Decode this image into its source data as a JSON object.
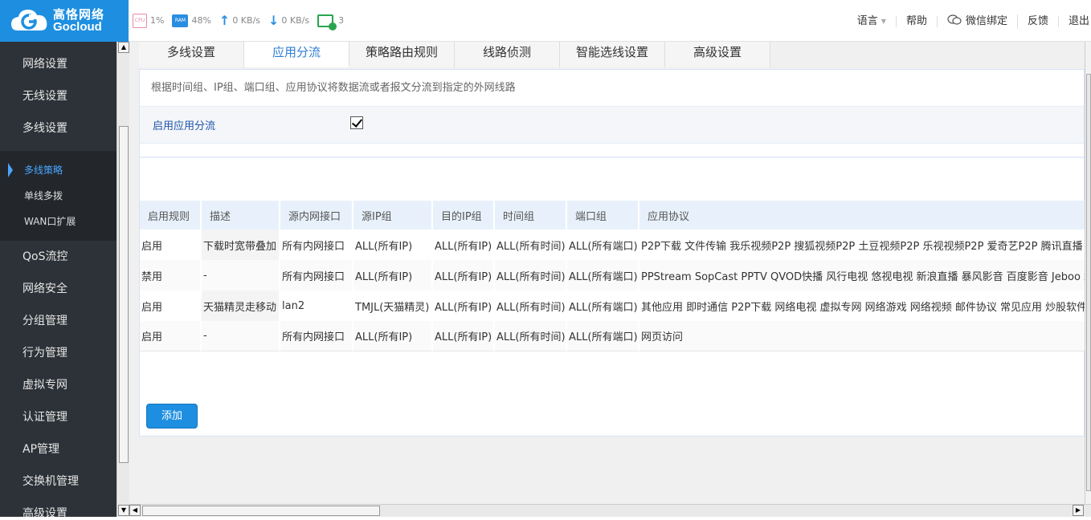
{
  "brand": {
    "name_cn": "高恪网络",
    "name_en": "Gocloud",
    "accent": "#1e8fe0"
  },
  "stats": {
    "cpu_label": "CPU",
    "cpu": "1%",
    "ram_label": "RAM",
    "ram": "48%",
    "upload": "0 KB/s",
    "download": "0 KB/s",
    "devices": "3"
  },
  "topnav": {
    "language": "语言",
    "help": "帮助",
    "wechat": "微信绑定",
    "feedback": "反馈",
    "logout": "退出"
  },
  "sidebar": {
    "items_top": [
      "网络设置",
      "无线设置",
      "多线设置"
    ],
    "submenu": [
      "多线策略",
      "单线多拨",
      "WAN口扩展"
    ],
    "active_sub": "多线策略",
    "items_bottom": [
      "QoS流控",
      "网络安全",
      "分组管理",
      "行为管理",
      "虚拟专网",
      "认证管理",
      "AP管理",
      "交换机管理",
      "高级设置"
    ]
  },
  "tabs": [
    "多线设置",
    "应用分流",
    "策略路由规则",
    "线路侦测",
    "智能选线设置",
    "高级设置"
  ],
  "active_tab": "应用分流",
  "panel": {
    "description": "根据时间组、IP组、端口组、应用协议将数据流或者报文分流到指定的外网线路",
    "enable_label": "启用应用分流",
    "enable_checked": true,
    "add_button": "添加"
  },
  "table": {
    "headers": [
      "启用规则",
      "描述",
      "源内网接口",
      "源IP组",
      "目的IP组",
      "时间组",
      "端口组",
      "应用协议"
    ],
    "rows": [
      [
        "启用",
        "下载时宽带叠加",
        "所有内网接口",
        "ALL(所有IP)",
        "ALL(所有IP)",
        "ALL(所有时间)",
        "ALL(所有端口)",
        "P2P下载 文件传输 我乐视频P2P 搜狐视频P2P 土豆视频P2P 乐视视频P2P 爱奇艺P2P 腾讯直播"
      ],
      [
        "禁用",
        "-",
        "所有内网接口",
        "ALL(所有IP)",
        "ALL(所有IP)",
        "ALL(所有时间)",
        "ALL(所有端口)",
        "PPStream SopCast PPTV QVOD快播 风行电视 悠视电视 新浪直播 暴风影音 百度影音 Jeboo 蚂"
      ],
      [
        "启用",
        "天猫精灵走移动",
        "lan2",
        "TMJL(天猫精灵)",
        "ALL(所有IP)",
        "ALL(所有时间)",
        "ALL(所有端口)",
        "其他应用 即时通信 P2P下载 网络电视 虚拟专网 网络游戏 网络视频 邮件协议 常见应用 炒股软件"
      ],
      [
        "启用",
        "-",
        "所有内网接口",
        "ALL(所有IP)",
        "ALL(所有IP)",
        "ALL(所有时间)",
        "ALL(所有端口)",
        "网页访问"
      ]
    ]
  }
}
